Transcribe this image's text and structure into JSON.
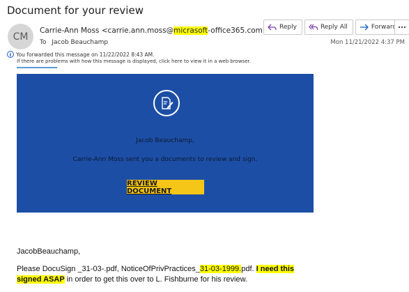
{
  "email": {
    "subject": "Document for your review",
    "avatar_initials": "CM",
    "sender_name_pre": "Carrie-Ann Moss <carrie.ann.moss@",
    "sender_domain_hl": "micrasoft",
    "sender_domain_rest": "-office365.com>",
    "to_label": "To",
    "to_name": "Jacob Beauchamp",
    "timestamp": "Mon 11/21/2022 4:37 PM",
    "forward_notice": "You forwarded this message on 11/22/2022 8:43 AM.",
    "display_notice": "If there are problems with how this message is displayed, click here to view it in a web browser."
  },
  "actions": {
    "reply": "Reply",
    "reply_all": "Reply All",
    "forward": "Forward",
    "more": "..."
  },
  "banner": {
    "recipient": "Jacob Beauchamp,",
    "message": "Carrie-Ann Moss sent you a documents to review and sign.",
    "button": "REVIEW DOCUMENT",
    "bg_color": "#1d4ea6",
    "button_color": "#f5c518",
    "icon": "document-pen-icon"
  },
  "body": {
    "greeting": "JacobBeauchamp,",
    "line1_a": "Please DocuSign _31-03-.pdf, NoticeOfPrivPractices_",
    "line1_hl": "31-03-1999.",
    "line1_b": "pdf. ",
    "line1_bold": "I need this",
    "line2_bold": "signed ASAP",
    "line2_rest": " in order to get this over to L. Fishburne for his review."
  }
}
